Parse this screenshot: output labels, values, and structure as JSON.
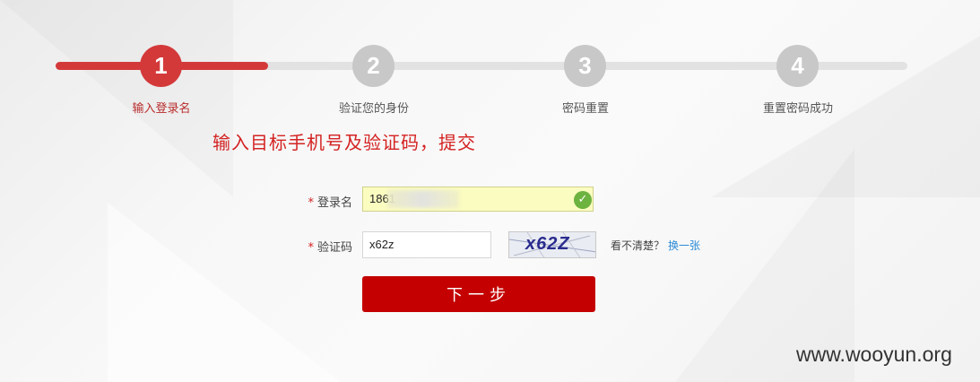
{
  "steps": [
    {
      "number": "1",
      "label": "输入登录名",
      "state": "active"
    },
    {
      "number": "2",
      "label": "验证您的身份",
      "state": "pending"
    },
    {
      "number": "3",
      "label": "密码重置",
      "state": "pending"
    },
    {
      "number": "4",
      "label": "重置密码成功",
      "state": "pending"
    }
  ],
  "progress_fraction": 0.25,
  "annotation": "输入目标手机号及验证码，提交",
  "form": {
    "required_mark": "*",
    "username_label": "登录名",
    "username_value": "1861",
    "code_label": "验证码",
    "code_value": "x62z",
    "captcha_text": "x62Z",
    "unclear_text": "看不清楚？",
    "change_link": "换一张",
    "next_button": "下一步"
  },
  "watermark": "www.wooyun.org",
  "colors": {
    "accent": "#d4393a",
    "button": "#c40000",
    "link": "#2b8ad6",
    "valid": "#6db33f"
  }
}
